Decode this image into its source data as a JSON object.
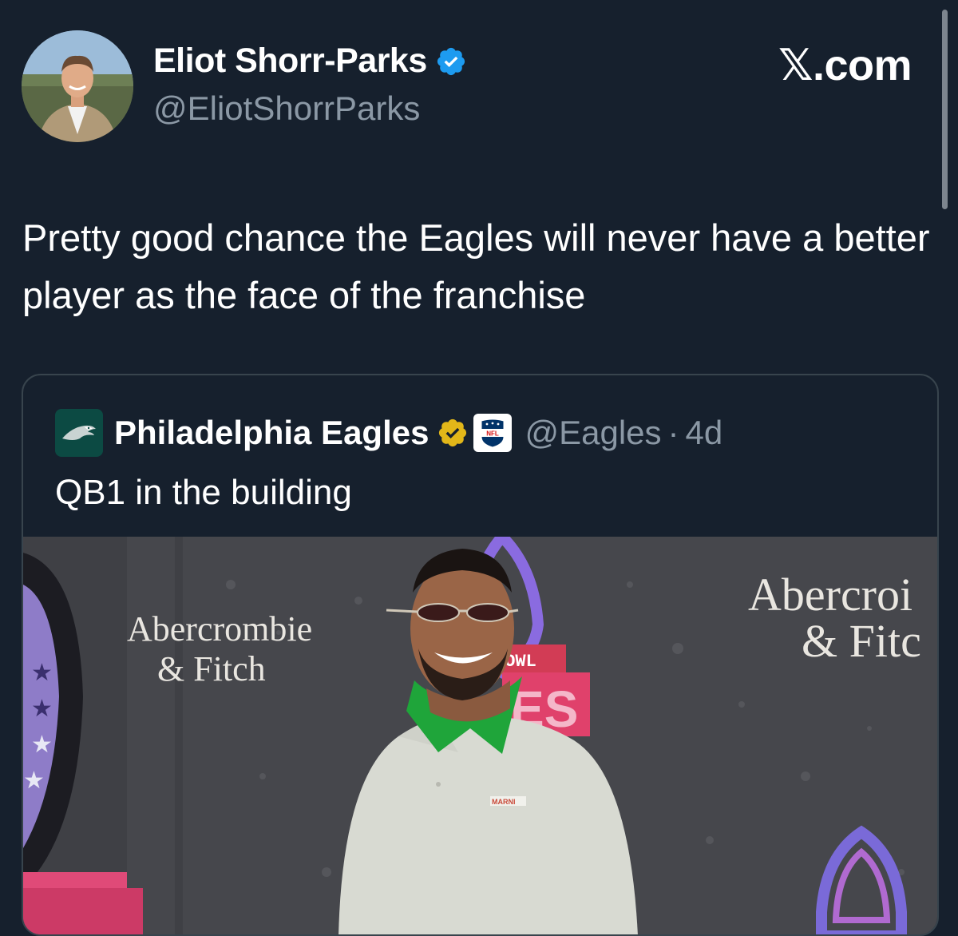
{
  "author": {
    "display_name": "Eliot Shorr-Parks",
    "handle": "@EliotShorrParks",
    "verified_icon": "blue-verified-badge-icon"
  },
  "brand": {
    "label": "𝕏.com"
  },
  "tweet": {
    "text": "Pretty good chance the Eagles will never have a better player as the face of the franchise"
  },
  "quoted_tweet": {
    "display_name": "Philadelphia Eagles",
    "handle": "@Eagles",
    "separator": "·",
    "time": "4d",
    "text": "QB1 in the building",
    "badges": [
      "gold-verified-badge-icon",
      "nfl-affiliate-badge-icon"
    ]
  },
  "media": {
    "banner_left_line1": "Abercrombie",
    "banner_left_line2": "& Fitch",
    "banner_right_line1": "Abercroi",
    "banner_right_line2": "& Fitc",
    "pro_bowl_label": "BOWL",
    "pro_bowl_partial": "ES",
    "shirt_label": "MARNI"
  },
  "colors": {
    "background": "#16202d",
    "verified_blue": "#1d9bf0",
    "verified_gold": "#e2b719",
    "muted_text": "#8b98a5",
    "card_border": "#38444d",
    "eagles_green": "#0c4a43",
    "collar_green": "#1fa53a"
  }
}
